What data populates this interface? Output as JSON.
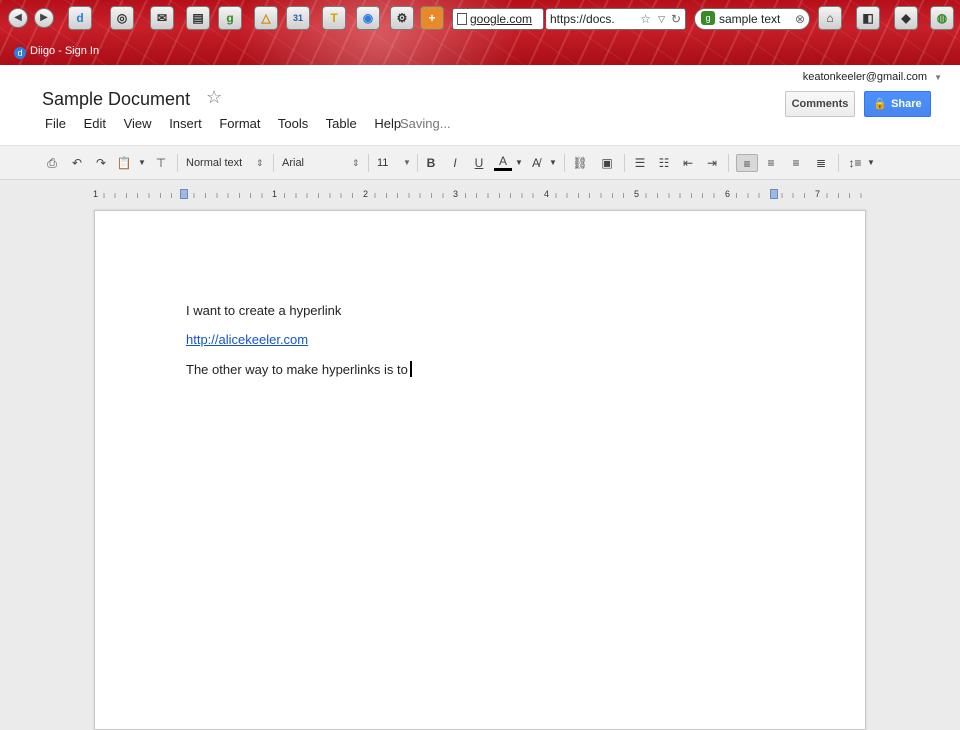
{
  "browser": {
    "address_domain": "google.com",
    "address_url": "https://docs.",
    "search_text": "sample text",
    "tab_title": "Diigo - Sign In"
  },
  "account": {
    "email": "keatonkeeler@gmail.com"
  },
  "document": {
    "title": "Sample Document",
    "status": "Saving...",
    "lines": [
      "I want to create a hyperlink",
      "http://alicekeeler.com",
      "The other way to make hyperlinks is to"
    ]
  },
  "menu": {
    "items": [
      "File",
      "Edit",
      "View",
      "Insert",
      "Format",
      "Tools",
      "Table",
      "Help"
    ]
  },
  "buttons": {
    "comments": "Comments",
    "share": "Share"
  },
  "toolbar": {
    "style": "Normal text",
    "font": "Arial",
    "size": "11"
  },
  "ruler": {
    "numbers": [
      "1",
      "1",
      "2",
      "3",
      "4",
      "5",
      "6",
      "7"
    ]
  },
  "colors": {
    "browser_theme": "#c8202a",
    "share_button": "#4d90fe",
    "link": "#1155cc"
  }
}
